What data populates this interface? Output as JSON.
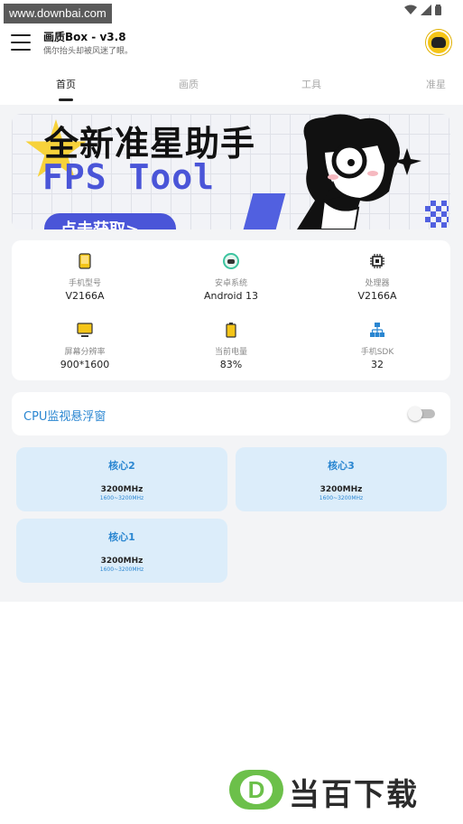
{
  "watermark": "www.downbai.com",
  "app": {
    "title": "画质Box - v3.8",
    "subtitle": "偶尔抬头却被风迷了眼。"
  },
  "tabs": [
    {
      "label": "首页",
      "active": true
    },
    {
      "label": "画质",
      "active": false
    },
    {
      "label": "工具",
      "active": false
    },
    {
      "label": "准星",
      "active": false
    }
  ],
  "banner": {
    "title": "全新准星助手",
    "subtitle": "FPS Tool",
    "cta": "点击获取>"
  },
  "device_info": [
    {
      "icon": "phone-icon",
      "label": "手机型号",
      "value": "V2166A"
    },
    {
      "icon": "android-icon",
      "label": "安卓系统",
      "value": "Android 13"
    },
    {
      "icon": "chip-icon",
      "label": "处理器",
      "value": "V2166A"
    },
    {
      "icon": "monitor-icon",
      "label": "屏幕分辨率",
      "value": "900*1600"
    },
    {
      "icon": "battery-icon",
      "label": "当前电量",
      "value": "83%"
    },
    {
      "icon": "network-icon",
      "label": "手机SDK",
      "value": "32"
    }
  ],
  "cpu_monitor": {
    "label": "CPU监视悬浮窗",
    "enabled": false
  },
  "cores": [
    {
      "name": "核心2",
      "freq": "3200MHz",
      "range": "1600~3200MHz"
    },
    {
      "name": "核心3",
      "freq": "3200MHz",
      "range": "1600~3200MHz"
    },
    {
      "name": "核心1",
      "freq": "3200MHz",
      "range": "1600~3200MHz"
    }
  ],
  "footer_brand": {
    "logo_letter": "D",
    "text": "当百下载"
  },
  "colors": {
    "accent": "#2a86d1",
    "core_bg": "#dcedfa",
    "banner_purple": "#4a55d8",
    "brand_green": "#6cc04a"
  }
}
